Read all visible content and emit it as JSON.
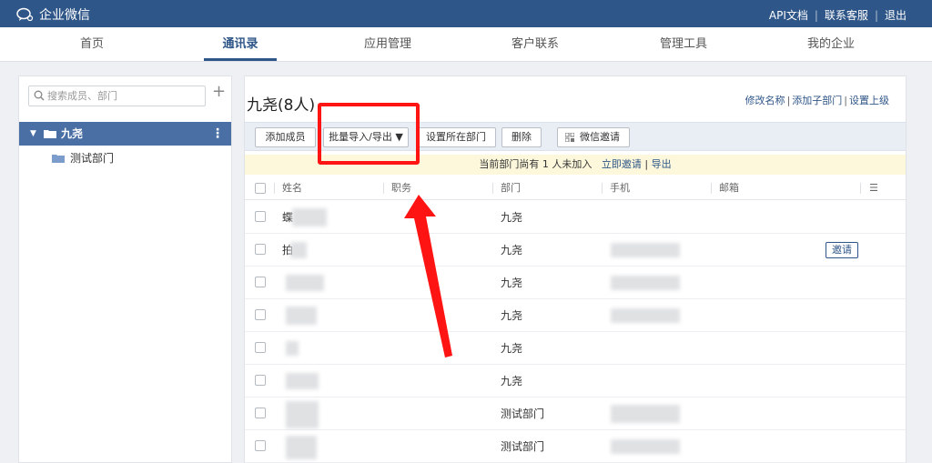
{
  "app": {
    "name": "企业微信"
  },
  "toplinks": [
    "API文档",
    "联系客服",
    "退出"
  ],
  "nav": {
    "tabs": [
      "首页",
      "通讯录",
      "应用管理",
      "客户联系",
      "管理工具",
      "我的企业"
    ],
    "active": 1
  },
  "sidebar": {
    "search_placeholder": "搜索成员、部门",
    "add_symbol": "+",
    "root": {
      "label": "九尧",
      "arrow": "▼",
      "more": "⋮"
    },
    "children": [
      {
        "label": "测试部门"
      }
    ]
  },
  "main": {
    "title": "九尧(8人)",
    "actions": [
      "修改名称",
      "添加子部门",
      "设置上级"
    ],
    "toolbar": {
      "add_member": "添加成员",
      "batch": "批量导入/导出 ▼",
      "set_dept": "设置所在部门",
      "delete": "删除",
      "wechat_invite": "微信邀请"
    },
    "notice": {
      "text": "当前部门尚有 1 人未加入",
      "invite": "立即邀请",
      "export": "导出"
    },
    "table": {
      "headers": [
        "姓名",
        "职务",
        "部门",
        "手机",
        "邮箱"
      ],
      "menu_icon": "☰",
      "invite_label": "邀请",
      "rows": [
        {
          "name": "蝶",
          "dept": "九尧",
          "phone_blurred": false,
          "invite": false
        },
        {
          "name": "拍",
          "dept": "九尧",
          "phone_blurred": true,
          "invite": true
        },
        {
          "name": "",
          "dept": "九尧",
          "phone_blurred": true,
          "invite": false
        },
        {
          "name": "",
          "dept": "九尧",
          "phone_blurred": true,
          "invite": false
        },
        {
          "name": "",
          "dept": "九尧",
          "phone_blurred": false,
          "invite": false
        },
        {
          "name": "",
          "dept": "九尧",
          "phone_blurred": false,
          "invite": false
        },
        {
          "name": "",
          "dept": "测试部门",
          "phone_blurred": true,
          "invite": false
        },
        {
          "name": "",
          "dept": "测试部门",
          "phone_blurred": true,
          "invite": false
        }
      ]
    }
  },
  "annotation": {
    "color": "#ff1414"
  },
  "colors": {
    "brand": "#2f5688",
    "selected": "#4a6fa5",
    "notice_bg": "#fdf8dc"
  }
}
